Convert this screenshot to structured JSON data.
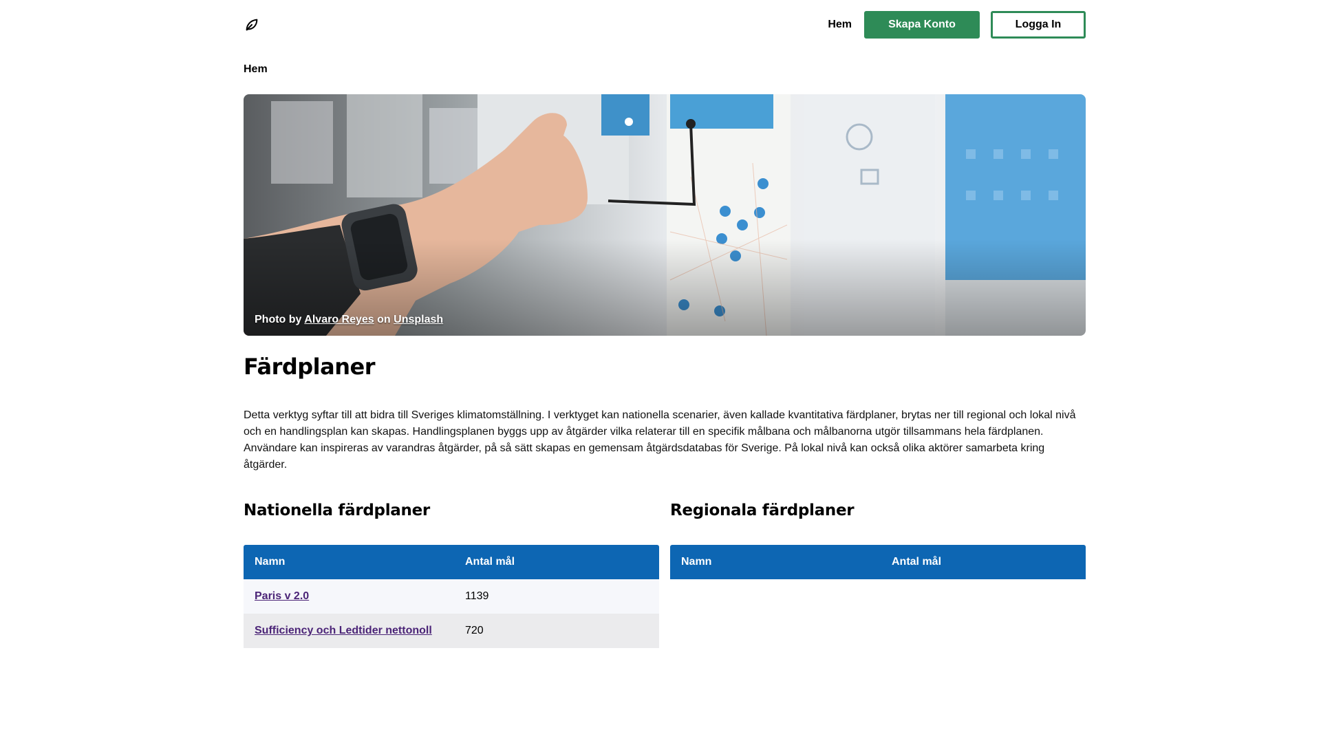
{
  "header": {
    "logo_icon": "leaf-icon",
    "nav_home": "Hem",
    "signup_label": "Skapa Konto",
    "login_label": "Logga In",
    "accent_color": "#2e8b57"
  },
  "breadcrumb": {
    "current": "Hem"
  },
  "hero": {
    "credit_prefix": "Photo by",
    "credit_author": "Alvaro Reyes",
    "credit_on": "on",
    "credit_source": "Unsplash"
  },
  "page": {
    "title": "Färdplaner",
    "description": "Detta verktyg syftar till att bidra till Sveriges klimatomställning. I verktyget kan nationella scenarier, även kallade kvantitativa färdplaner, brytas ner till regional och lokal nivå och en handlingsplan kan skapas. Handlingsplanen byggs upp av åtgärder vilka relaterar till en specifik målbana och målbanorna utgör tillsammans hela färdplanen. Användare kan inspireras av varandras åtgärder, på så sätt skapas en gemensam åtgärdsdatabas för Sverige. På lokal nivå kan också olika aktörer samarbeta kring åtgärder."
  },
  "national": {
    "heading": "Nationella färdplaner",
    "columns": [
      "Namn",
      "Antal mål"
    ],
    "rows": [
      {
        "name": "Paris v 2.0",
        "goals": "1139"
      },
      {
        "name": "Sufficiency och Ledtider nettonoll",
        "goals": "720"
      }
    ]
  },
  "regional": {
    "heading": "Regionala färdplaner",
    "columns": [
      "Namn",
      "Antal mål"
    ],
    "rows": []
  },
  "colors": {
    "table_header": "#0d66b3",
    "link": "#4b2477"
  }
}
